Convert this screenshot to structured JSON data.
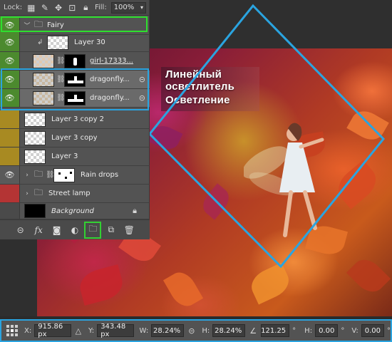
{
  "lock_bar": {
    "lock_label": "Lock:",
    "fill_label": "Fill:",
    "fill_value": "100%"
  },
  "canvas": {
    "overlay_line1": "Линейный",
    "overlay_line2": "осветлитель",
    "overlay_line3": "Осветление"
  },
  "layers": [
    {
      "name": "Fairy",
      "eye_color": "green",
      "kind": "group",
      "expanded": true
    },
    {
      "name": "Layer 30",
      "eye_color": "green",
      "kind": "clipped"
    },
    {
      "name": "girl-17333...",
      "eye_color": "green",
      "kind": "masked"
    },
    {
      "name": "dragonfly...",
      "eye_color": "green",
      "kind": "masked-linked",
      "selected": true
    },
    {
      "name": "dragonfly...",
      "eye_color": "green",
      "kind": "masked-linked",
      "selected": true
    },
    {
      "name": "Layer 3 copy 2",
      "eye_color": "yellow",
      "kind": "pixel"
    },
    {
      "name": "Layer 3 copy",
      "eye_color": "yellow",
      "kind": "pixel"
    },
    {
      "name": "Layer 3",
      "eye_color": "yellow",
      "kind": "pixel"
    },
    {
      "name": "Rain drops",
      "eye_color": "gray",
      "kind": "group-masked"
    },
    {
      "name": "Street lamp",
      "eye_color": "red",
      "kind": "group"
    },
    {
      "name": "Background",
      "eye_color": "dark",
      "kind": "background"
    }
  ],
  "options_bar": {
    "x_label": "X:",
    "x_value": "915.86 px",
    "y_label": "Y:",
    "y_value": "343.48 px",
    "w_label": "W:",
    "w_value": "28.24%",
    "h_label": "H:",
    "h_value": "28.24%",
    "angle_value": "121.25",
    "angle_unit": "°",
    "hskew_label": "H:",
    "hskew_value": "0.00",
    "hskew_unit": "°",
    "vskew_label": "V:",
    "vskew_value": "0.00",
    "vskew_unit": "°"
  },
  "colors": {
    "highlight_green": "#2ee02e",
    "highlight_blue": "#2aa4e0",
    "eye_green": "#4c8a2e",
    "eye_yellow": "#a88a22",
    "eye_red": "#b43434"
  }
}
